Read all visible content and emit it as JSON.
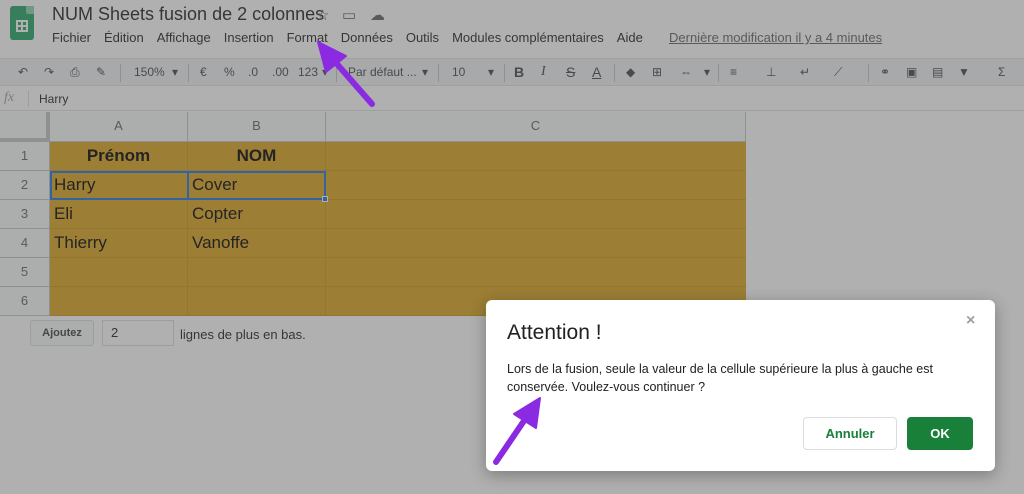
{
  "app": {
    "doc_title": "NUM Sheets fusion de 2 colonnes",
    "last_edit": "Dernière modification il y a 4 minutes"
  },
  "menu": [
    "Fichier",
    "Édition",
    "Affichage",
    "Insertion",
    "Format",
    "Données",
    "Outils",
    "Modules complémentaires",
    "Aide"
  ],
  "toolbar": {
    "zoom": "150%",
    "currency": "€",
    "percent": "%",
    "dec_less": ".0",
    "dec_more": ".00",
    "more_formats": "123",
    "font": "Par défaut ...",
    "font_size": "10",
    "bold": "B",
    "italic": "I",
    "strike": "S",
    "text_color": "A",
    "function": "Σ"
  },
  "formula_bar": {
    "fx": "fx",
    "value": "Harry"
  },
  "columns": [
    "A",
    "B",
    "C"
  ],
  "rows": [
    "1",
    "2",
    "3",
    "4",
    "5",
    "6"
  ],
  "cells": {
    "A1": "Prénom",
    "B1": "NOM",
    "A2": "Harry",
    "B2": "Cover",
    "A3": "Eli",
    "B3": "Copter",
    "A4": "Thierry",
    "B4": "Vanoffe"
  },
  "add_rows": {
    "button": "Ajoutez",
    "value": "2",
    "label": "lignes de plus en bas."
  },
  "dialog": {
    "title": "Attention !",
    "close": "×",
    "message": "Lors de la fusion, seule la valeur de la cellule supérieure la plus à gauche est conservée. Voulez-vous continuer ?",
    "cancel": "Annuler",
    "ok": "OK"
  },
  "colors": {
    "cell_fill": "#daa520",
    "ok_button": "#188038",
    "arrow": "#8a2be2",
    "selection": "#1a73e8"
  }
}
